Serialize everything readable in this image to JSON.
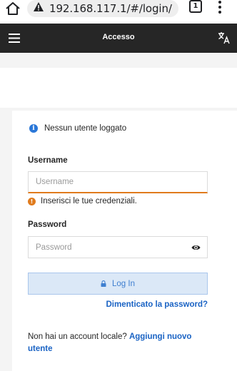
{
  "browser": {
    "url": "192.168.117.1/#/login/",
    "tab_count": "1",
    "icons": {
      "home": "home-icon",
      "security": "warning-icon",
      "menu": "more-vert-icon"
    }
  },
  "header": {
    "title": "Accesso",
    "icons": {
      "menu": "hamburger-icon",
      "language": "translate-icon"
    }
  },
  "login": {
    "info_text": "Nessun utente loggato",
    "username_label": "Username",
    "username_placeholder": "Username",
    "username_value": "",
    "error_text": "Inserisci le tue credenziali.",
    "password_label": "Password",
    "password_placeholder": "Password",
    "password_value": "",
    "login_button": "Log In",
    "forgot_password": "Dimenticato la password?",
    "no_account_text": "Non hai un account locale?",
    "add_user_link": "Aggiungi nuovo utente"
  },
  "colors": {
    "header_bg": "#262626",
    "accent_blue": "#1a63c4",
    "error_orange": "#e07b1d",
    "button_bg": "#dbe8f7"
  }
}
